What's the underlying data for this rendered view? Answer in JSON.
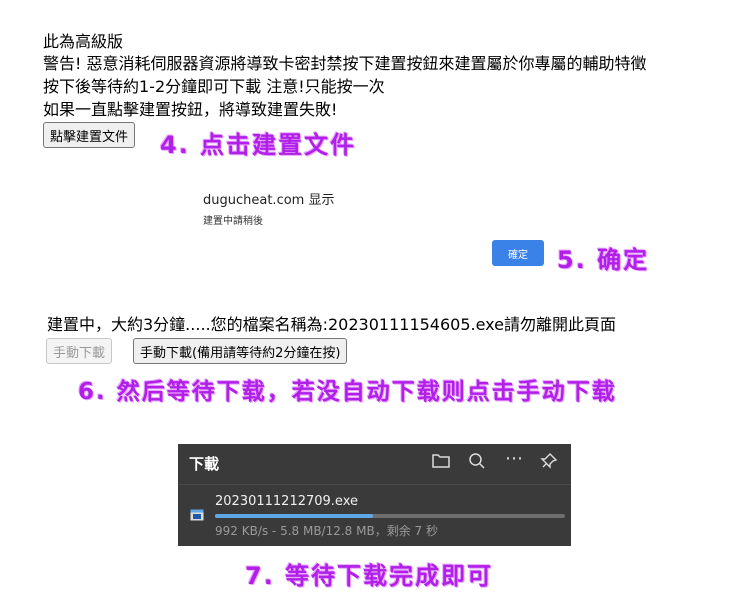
{
  "warning": {
    "line1": "此為高級版",
    "line2": "警告! 惡意消耗伺服器資源將導致卡密封禁按下建置按鈕來建置屬於你專屬的輔助特徵",
    "line3": "按下後等待約1-2分鐘即可下載 注意!只能按一次",
    "line4": "如果一直點擊建置按鈕，將導致建置失敗!"
  },
  "build_button_label": "點擊建置文件",
  "annotations": {
    "step4": "4. 点击建置文件",
    "step5": "5. 确定",
    "step6": "6. 然后等待下载，若没自动下载则点击手动下载",
    "step7": "7. 等待下载完成即可"
  },
  "dialog": {
    "title": "dugucheat.com 显示",
    "message": "建置中請稍後",
    "ok_label": "確定"
  },
  "status": {
    "text": "建置中，大約3分鐘.....您的檔案名稱為:20230111154605.exe請勿離開此頁面",
    "manual_download_label": "手動下載",
    "manual_download_backup_label": "手動下載(備用請等待約2分鐘在按)"
  },
  "download_panel": {
    "title": "下載",
    "filename": "20230111212709.exe",
    "progress_text": "992 KB/s - 5.8 MB/12.8 MB，剩余 7 秒",
    "progress_fraction": 0.45,
    "colors": {
      "bg": "#3a3a3a",
      "progress_fill": "#5fa8e8",
      "progress_track": "#6e6e6e"
    }
  },
  "colors": {
    "annotation": "#b020e8",
    "ok_button": "#3b82e8"
  }
}
